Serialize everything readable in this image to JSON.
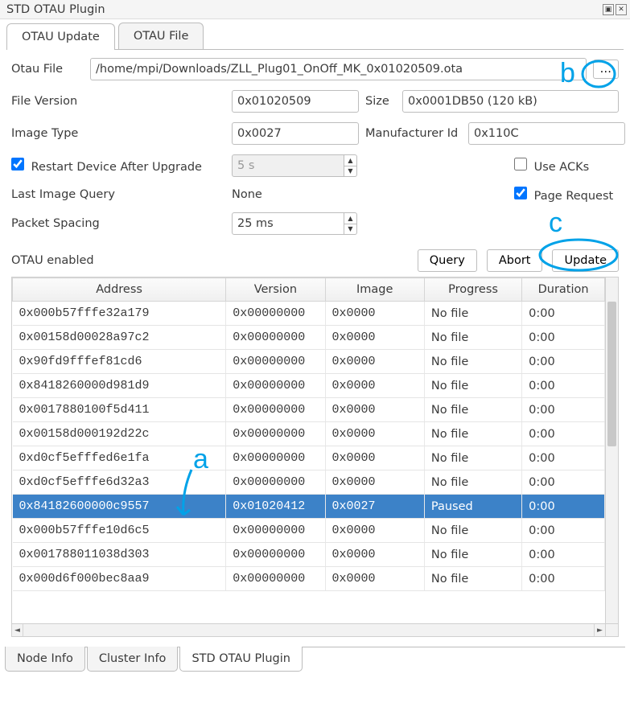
{
  "window": {
    "title": "STD OTAU Plugin"
  },
  "tabs_top": [
    {
      "label": "OTAU Update",
      "active": true
    },
    {
      "label": "OTAU File",
      "active": false
    }
  ],
  "form": {
    "otau_file_label": "Otau File",
    "otau_file_value": "/home/mpi/Downloads/ZLL_Plug01_OnOff_MK_0x01020509.ota",
    "browse_label": "…",
    "file_version_label": "File Version",
    "file_version_value": "0x01020509",
    "size_label": "Size",
    "size_value": "0x0001DB50 (120 kB)",
    "image_type_label": "Image Type",
    "image_type_value": "0x0027",
    "manufacturer_id_label": "Manufacturer Id",
    "manufacturer_id_value": "0x110C",
    "restart_label": "Restart Device After Upgrade",
    "restart_checked": true,
    "restart_delay_value": "5 s",
    "use_acks_label": "Use ACKs",
    "use_acks_checked": false,
    "last_image_query_label": "Last Image Query",
    "last_image_query_value": "None",
    "page_request_label": "Page Request",
    "page_request_checked": true,
    "packet_spacing_label": "Packet Spacing",
    "packet_spacing_value": "25 ms",
    "otau_enabled_label": "OTAU enabled"
  },
  "actions": {
    "query": "Query",
    "abort": "Abort",
    "update": "Update"
  },
  "table": {
    "headers": [
      "Address",
      "Version",
      "Image",
      "Progress",
      "Duration"
    ],
    "rows": [
      {
        "address": "0x000b57fffe32a179",
        "version": "0x00000000",
        "image": "0x0000",
        "progress": "No file",
        "duration": "0:00",
        "selected": false
      },
      {
        "address": "0x00158d00028a97c2",
        "version": "0x00000000",
        "image": "0x0000",
        "progress": "No file",
        "duration": "0:00",
        "selected": false
      },
      {
        "address": "0x90fd9fffef81cd6",
        "version": "0x00000000",
        "image": "0x0000",
        "progress": "No file",
        "duration": "0:00",
        "selected": false
      },
      {
        "address": "0x8418260000d981d9",
        "version": "0x00000000",
        "image": "0x0000",
        "progress": "No file",
        "duration": "0:00",
        "selected": false
      },
      {
        "address": "0x0017880100f5d411",
        "version": "0x00000000",
        "image": "0x0000",
        "progress": "No file",
        "duration": "0:00",
        "selected": false
      },
      {
        "address": "0x00158d000192d22c",
        "version": "0x00000000",
        "image": "0x0000",
        "progress": "No file",
        "duration": "0:00",
        "selected": false
      },
      {
        "address": "0xd0cf5efffed6e1fa",
        "version": "0x00000000",
        "image": "0x0000",
        "progress": "No file",
        "duration": "0:00",
        "selected": false
      },
      {
        "address": "0xd0cf5efffe6d32a3",
        "version": "0x00000000",
        "image": "0x0000",
        "progress": "No file",
        "duration": "0:00",
        "selected": false
      },
      {
        "address": "0x84182600000c9557",
        "version": "0x01020412",
        "image": "0x0027",
        "progress": "Paused",
        "duration": "0:00",
        "selected": true
      },
      {
        "address": "0x000b57fffe10d6c5",
        "version": "0x00000000",
        "image": "0x0000",
        "progress": "No file",
        "duration": "0:00",
        "selected": false
      },
      {
        "address": "0x001788011038d303",
        "version": "0x00000000",
        "image": "0x0000",
        "progress": "No file",
        "duration": "0:00",
        "selected": false
      },
      {
        "address": "0x000d6f000bec8aa9",
        "version": "0x00000000",
        "image": "0x0000",
        "progress": "No file",
        "duration": "0:00",
        "selected": false
      }
    ]
  },
  "tabs_bottom": [
    {
      "label": "Node Info",
      "active": false
    },
    {
      "label": "Cluster Info",
      "active": false
    },
    {
      "label": "STD OTAU Plugin",
      "active": true
    }
  ],
  "annotations": {
    "a": "a",
    "b": "b",
    "c": "c"
  }
}
